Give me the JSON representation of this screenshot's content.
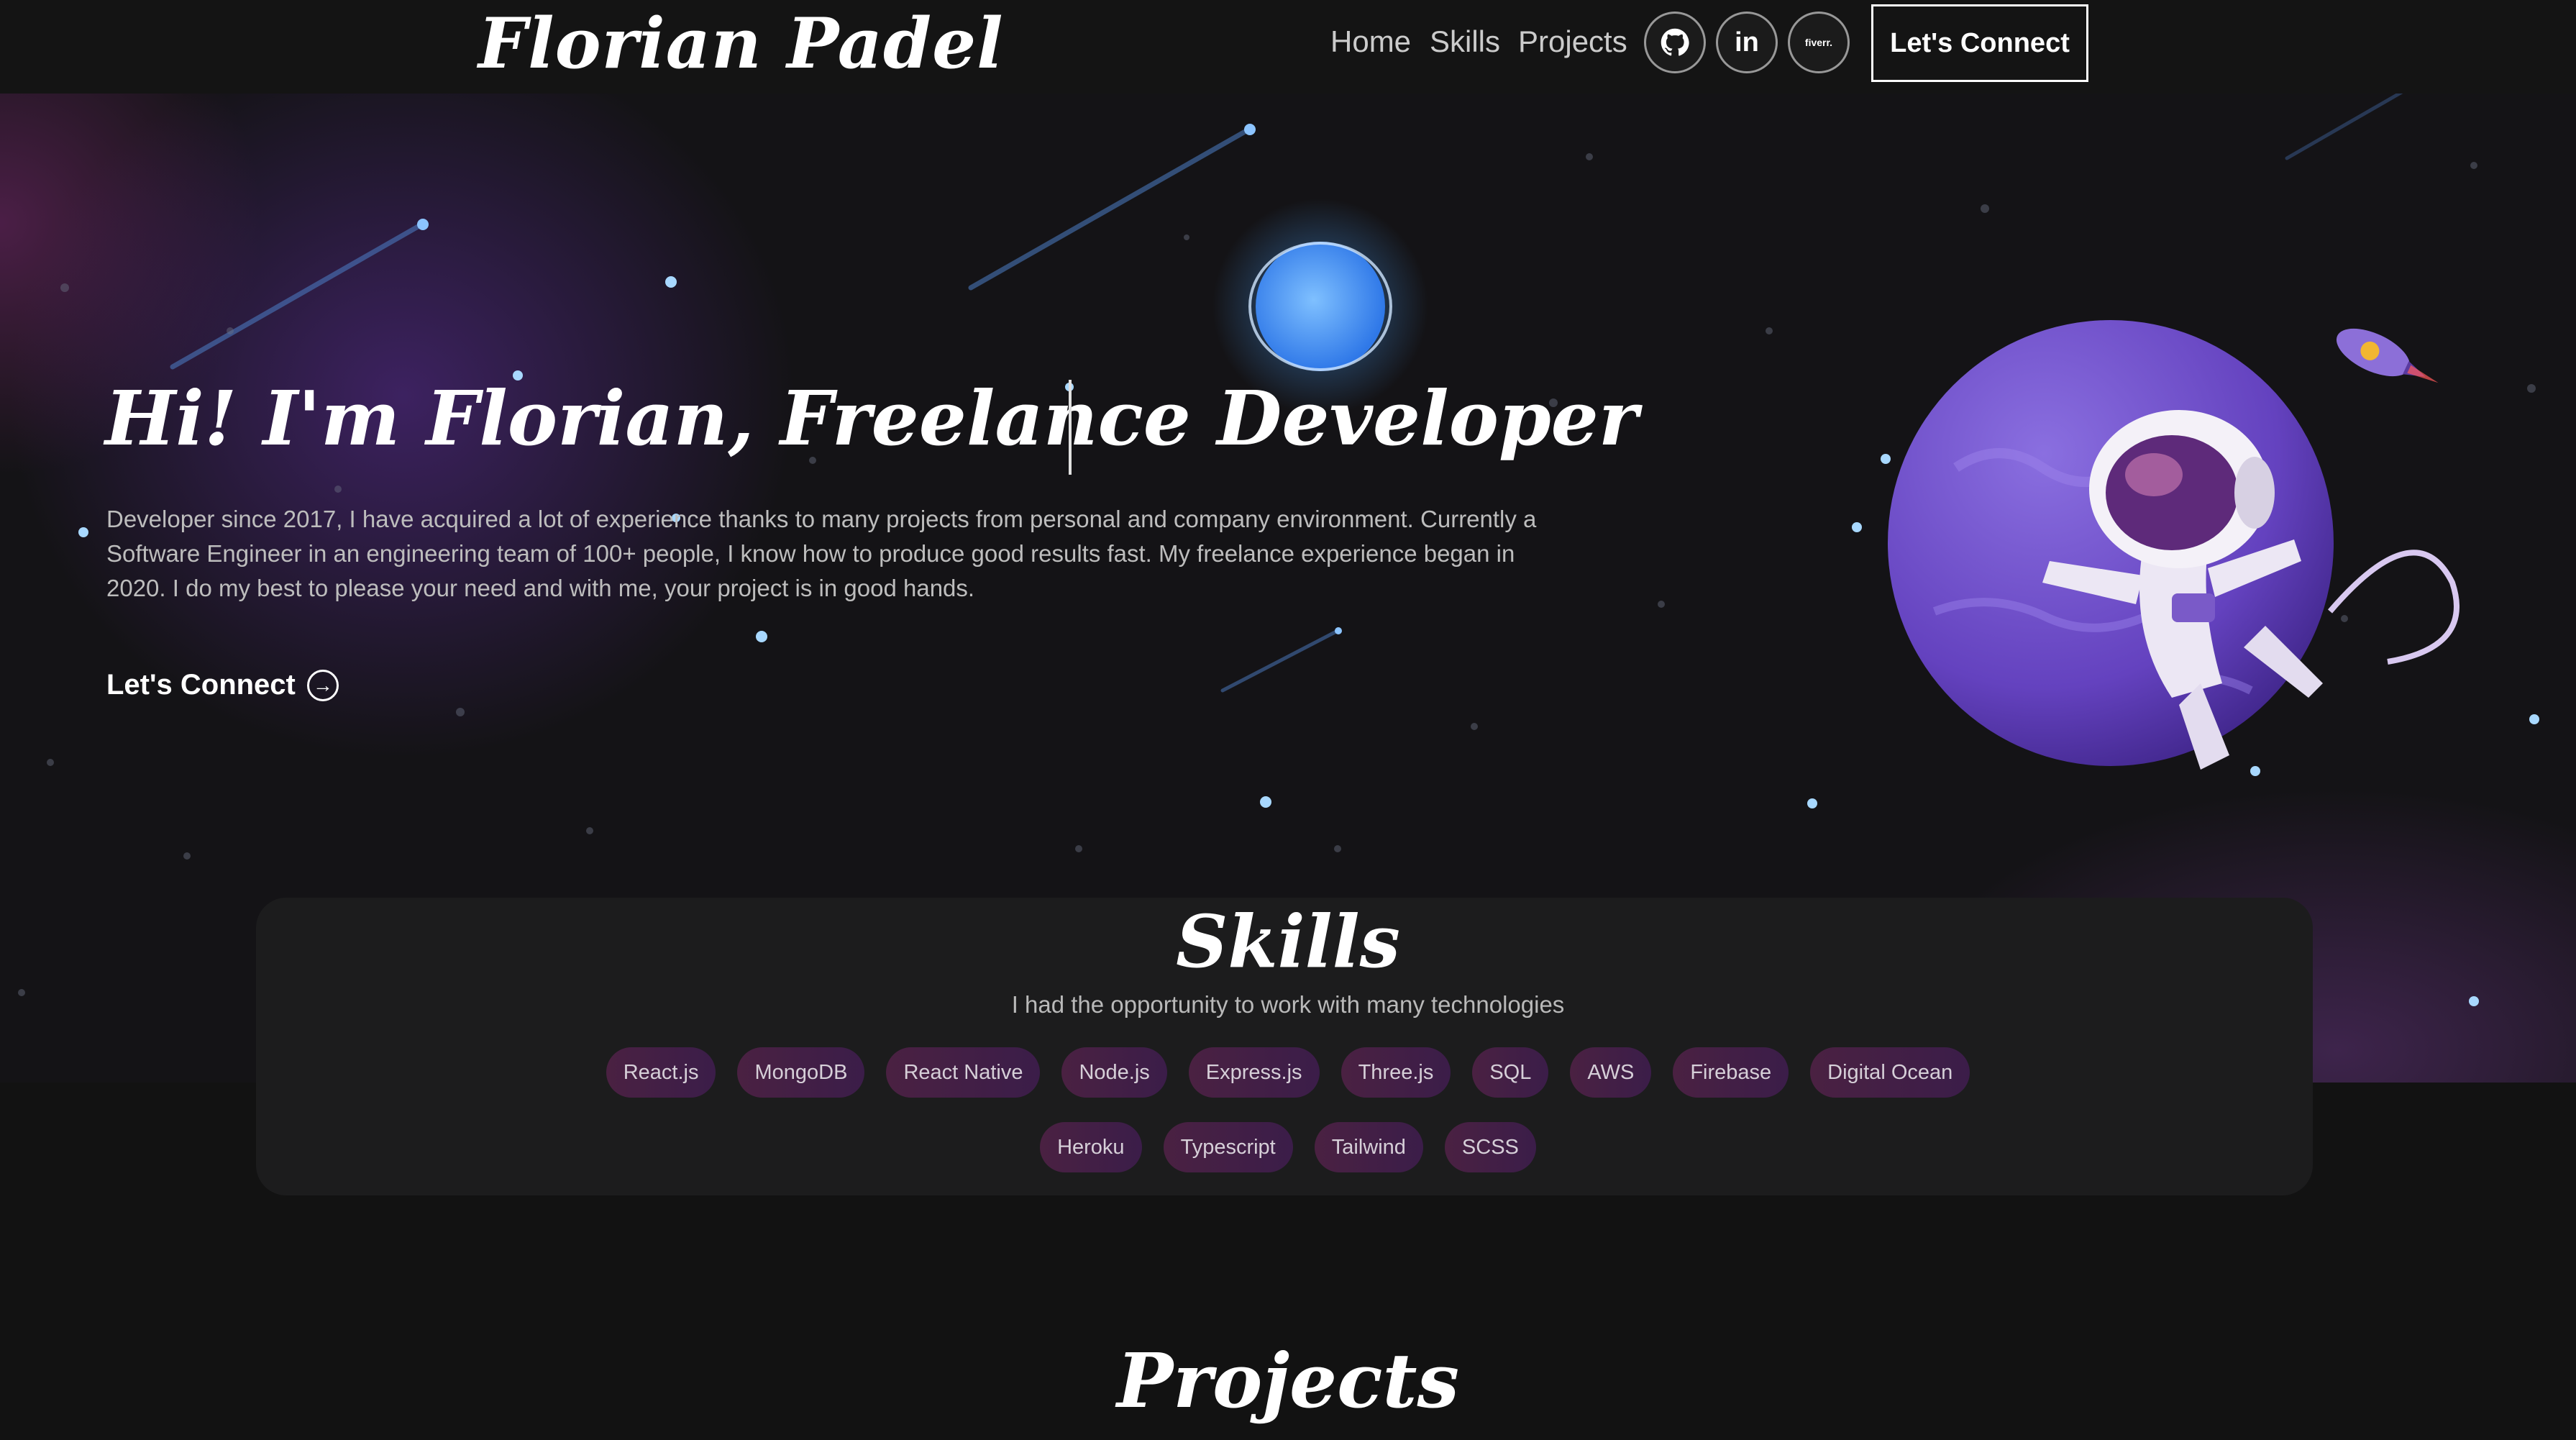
{
  "nav": {
    "logo": "Florian Padel",
    "links": [
      "Home",
      "Skills",
      "Projects"
    ],
    "social": [
      {
        "name": "github-icon",
        "glyph": ""
      },
      {
        "name": "linkedin-icon",
        "glyph": "in"
      },
      {
        "name": "fiverr-icon",
        "glyph": "fiverr."
      }
    ],
    "connect_label": "Let's Connect"
  },
  "hero": {
    "title": "Hi! I'm Florian, Freelance Developer",
    "description": "Developer since 2017, I have acquired a lot of experience thanks to many projects from personal and company environment. Currently a Software Engineer in an engineering team of 100+ people, I know how to produce good results fast. My freelance experience began in 2020. I do my best to please your need and with me, your project is in good hands.",
    "connect_label": "Let's Connect"
  },
  "skills": {
    "title": "Skills",
    "subtitle": "I had the opportunity to work with many technologies",
    "row1": [
      "React.js",
      "MongoDB",
      "React Native",
      "Node.js",
      "Express.js",
      "Three.js",
      "SQL",
      "AWS",
      "Firebase",
      "Digital Ocean"
    ],
    "row2": [
      "Heroku",
      "Typescript",
      "Tailwind",
      "SCSS"
    ]
  },
  "projects": {
    "title": "Projects"
  },
  "colors": {
    "background": "#121212",
    "chip": "#4a2142",
    "planet": "#6a4bc4",
    "glow_blue": "#4aa3ff"
  }
}
